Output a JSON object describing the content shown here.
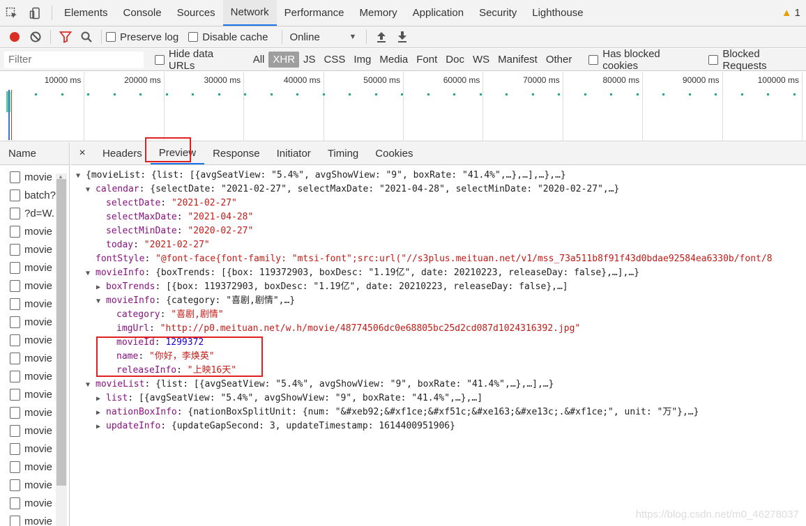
{
  "tabs": [
    "Elements",
    "Console",
    "Sources",
    "Network",
    "Performance",
    "Memory",
    "Application",
    "Security",
    "Lighthouse"
  ],
  "active_tab": "Network",
  "warning_count": "1",
  "toolbar": {
    "preserve_log": "Preserve log",
    "disable_cache": "Disable cache",
    "throttle": "Online"
  },
  "filterbar": {
    "placeholder": "Filter",
    "hide_data_urls": "Hide data URLs",
    "types": [
      "All",
      "XHR",
      "JS",
      "CSS",
      "Img",
      "Media",
      "Font",
      "Doc",
      "WS",
      "Manifest",
      "Other"
    ],
    "active_type": "XHR",
    "has_blocked_cookies": "Has blocked cookies",
    "blocked_requests": "Blocked Requests"
  },
  "timeline_ticks": [
    "10000 ms",
    "20000 ms",
    "30000 ms",
    "40000 ms",
    "50000 ms",
    "60000 ms",
    "70000 ms",
    "80000 ms",
    "90000 ms",
    "100000 ms"
  ],
  "name_header": "Name",
  "requests": [
    "movie",
    "batch?",
    "?d=W.",
    "movie",
    "movie",
    "movie",
    "movie",
    "movie",
    "movie",
    "movie",
    "movie",
    "movie",
    "movie",
    "movie",
    "movie",
    "movie",
    "movie",
    "movie",
    "movie",
    "movie"
  ],
  "detail_tabs": [
    "Headers",
    "Preview",
    "Response",
    "Initiator",
    "Timing",
    "Cookies"
  ],
  "active_detail_tab": "Preview",
  "close_glyph": "×",
  "tree": [
    {
      "indent": 0,
      "arrow": "down",
      "key": "",
      "text": "{movieList: {list: [{avgSeatView: \"5.4%\", avgShowView: \"9\", boxRate: \"41.4%\",…},…],…},…}"
    },
    {
      "indent": 1,
      "arrow": "down",
      "key": "calendar",
      "text": ": {selectDate: \"2021-02-27\", selectMaxDate: \"2021-04-28\", selectMinDate: \"2020-02-27\",…}"
    },
    {
      "indent": 2,
      "arrow": "",
      "key": "selectDate",
      "sep": ": ",
      "val": "\"2021-02-27\"",
      "vtype": "str"
    },
    {
      "indent": 2,
      "arrow": "",
      "key": "selectMaxDate",
      "sep": ": ",
      "val": "\"2021-04-28\"",
      "vtype": "str"
    },
    {
      "indent": 2,
      "arrow": "",
      "key": "selectMinDate",
      "sep": ": ",
      "val": "\"2020-02-27\"",
      "vtype": "str"
    },
    {
      "indent": 2,
      "arrow": "",
      "key": "today",
      "sep": ": ",
      "val": "\"2021-02-27\"",
      "vtype": "str"
    },
    {
      "indent": 1,
      "arrow": "",
      "key": "fontStyle",
      "sep": ": ",
      "val": "\"@font-face{font-family: \"mtsi-font\";src:url(\"//s3plus.meituan.net/v1/mss_73a511b8f91f43d0bdae92584ea6330b/font/8",
      "vtype": "str"
    },
    {
      "indent": 1,
      "arrow": "down",
      "key": "movieInfo",
      "text": ": {boxTrends: [{box: 119372903, boxDesc: \"1.19亿\", date: 20210223, releaseDay: false},…],…}"
    },
    {
      "indent": 2,
      "arrow": "right",
      "key": "boxTrends",
      "text": ": [{box: 119372903, boxDesc: \"1.19亿\", date: 20210223, releaseDay: false},…]"
    },
    {
      "indent": 2,
      "arrow": "down",
      "key": "movieInfo",
      "text": ": {category: \"喜剧,剧情\",…}"
    },
    {
      "indent": 3,
      "arrow": "",
      "key": "category",
      "sep": ": ",
      "val": "\"喜剧,剧情\"",
      "vtype": "str"
    },
    {
      "indent": 3,
      "arrow": "",
      "key": "imgUrl",
      "sep": ": ",
      "val": "\"http://p0.meituan.net/w.h/movie/48774506dc0e68805bc25d2cd087d1024316392.jpg\"",
      "vtype": "str"
    },
    {
      "indent": 3,
      "arrow": "",
      "key": "movieId",
      "sep": ": ",
      "val": "1299372",
      "vtype": "num"
    },
    {
      "indent": 3,
      "arrow": "",
      "key": "name",
      "sep": ": ",
      "val": "\"你好，李焕英\"",
      "vtype": "str"
    },
    {
      "indent": 3,
      "arrow": "",
      "key": "releaseInfo",
      "sep": ": ",
      "val": "\"上映16天\"",
      "vtype": "str"
    },
    {
      "indent": 1,
      "arrow": "down",
      "key": "movieList",
      "text": ": {list: [{avgSeatView: \"5.4%\", avgShowView: \"9\", boxRate: \"41.4%\",…},…],…}"
    },
    {
      "indent": 2,
      "arrow": "right",
      "key": "list",
      "text": ": [{avgSeatView: \"5.4%\", avgShowView: \"9\", boxRate: \"41.4%\",…},…]"
    },
    {
      "indent": 2,
      "arrow": "right",
      "key": "nationBoxInfo",
      "text": ": {nationBoxSplitUnit: {num: \"&#xeb92;&#xf1ce;&#xf51c;&#xe163;&#xe13c;.&#xf1ce;\", unit: \"万\"},…}"
    },
    {
      "indent": 2,
      "arrow": "right",
      "key": "updateInfo",
      "text": ": {updateGapSecond: 3, updateTimestamp: 1614400951906}"
    }
  ],
  "watermark": "https://blog.csdn.net/m0_46278037",
  "colors": {
    "accent": "#1a73e8",
    "highlight": "#e02020",
    "key": "#881280",
    "string": "#c41a16",
    "number": "#1c00cf"
  }
}
